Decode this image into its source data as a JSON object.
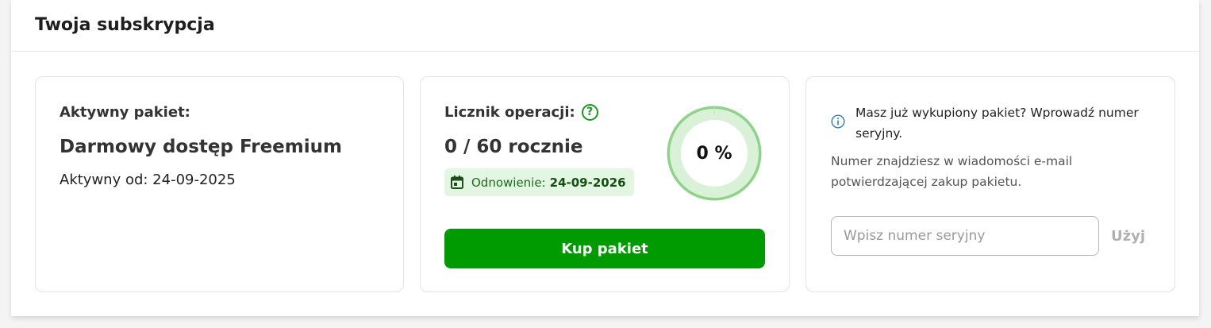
{
  "header": {
    "title": "Twoja subskrypcja"
  },
  "active_package": {
    "label": "Aktywny pakiet:",
    "name": "Darmowy dostęp Freemium",
    "active_since": "Aktywny od: 24-09-2025"
  },
  "operations": {
    "label": "Licznik operacji:",
    "help_icon": "question-circle-icon",
    "counter": "0 / 60 rocznie",
    "renewal_label": "Odnowienie:",
    "renewal_date": "24-09-2026",
    "calendar_icon": "calendar-icon",
    "usage_percent": 0,
    "usage_text": "0 %",
    "buy_button": "Kup pakiet"
  },
  "serial": {
    "info_icon": "info-circle-icon",
    "info_text": "Masz już wykupiony pakiet? Wprowadź numer seryjny.",
    "hint_text": "Numer znajdziesz w wiadomości e-mail potwierdzającej zakup pakietu.",
    "input_value": "",
    "input_placeholder": "Wpisz numer seryjny",
    "use_button": "Użyj"
  },
  "colors": {
    "accent_green": "#009b00",
    "gauge_track": "#d9f2d7",
    "gauge_ring": "#8fd38b",
    "badge_bg": "#e3f6e1",
    "info_blue": "#2b7bd1"
  }
}
